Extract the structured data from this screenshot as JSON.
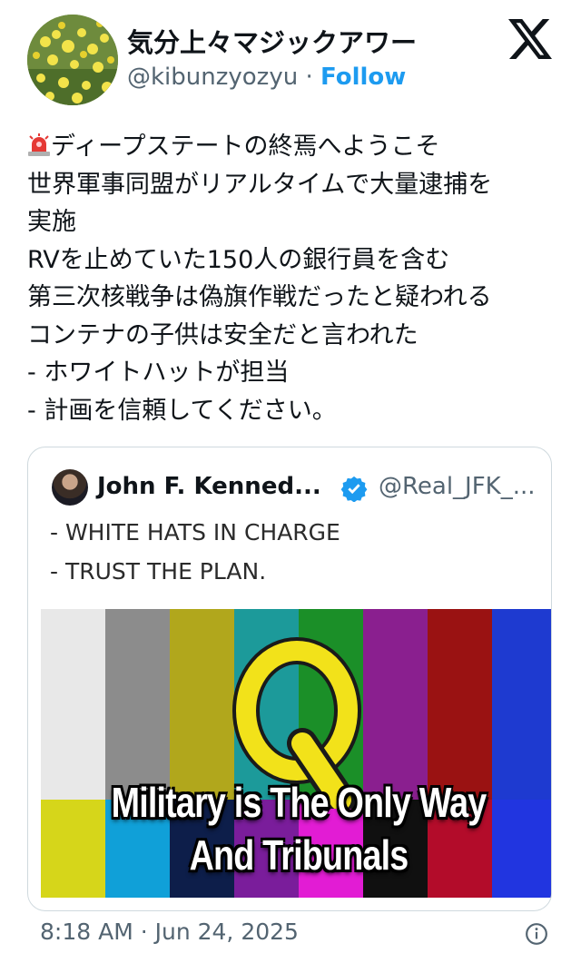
{
  "author": {
    "display_name": "気分上々マジックアワー",
    "handle": "@kibunzyozyu",
    "separator": "·",
    "follow_label": "Follow",
    "avatar": "rapeseed-flowers-avatar"
  },
  "brand_icon": "x-logo-icon",
  "tweet": {
    "lead_icon": "siren-emoji",
    "lines": [
      "ディープステートの終焉へようこそ",
      "世界軍事同盟がリアルタイムで大量逮捕を",
      "実施",
      "RVを止めていた150人の銀行員を含む",
      "第三次核戦争は偽旗作戦だったと疑われる",
      "コンテナの子供は安全だと言われた",
      "- ホワイトハットが担当",
      "- 計画を信頼してください。"
    ]
  },
  "quote": {
    "name": "John F. Kenned...",
    "verified_icon": "verified-badge-icon",
    "handle": "@Real_JFK_...",
    "lines": [
      "- WHITE HATS IN CHARGE",
      "- TRUST THE PLAN."
    ],
    "image": {
      "letter": "Q",
      "caption_line1": "Military is The Only Way",
      "caption_line2": "And Tribunals",
      "bar_colors": [
        "#e8e8e8",
        "#8c8c8c",
        "#b1a71c",
        "#1c9a9a",
        "#1b8f28",
        "#8a1f8f",
        "#9a1212",
        "#1e3ad0"
      ],
      "low_colors": [
        "#d6d61a",
        "#10a0d8",
        "#0d1e4a",
        "#7a1d9b",
        "#e21cd4",
        "#101010",
        "#b30c2a",
        "#2135e0"
      ]
    }
  },
  "timestamp": "8:18 AM · Jun 24, 2025",
  "info_icon": "info-icon"
}
